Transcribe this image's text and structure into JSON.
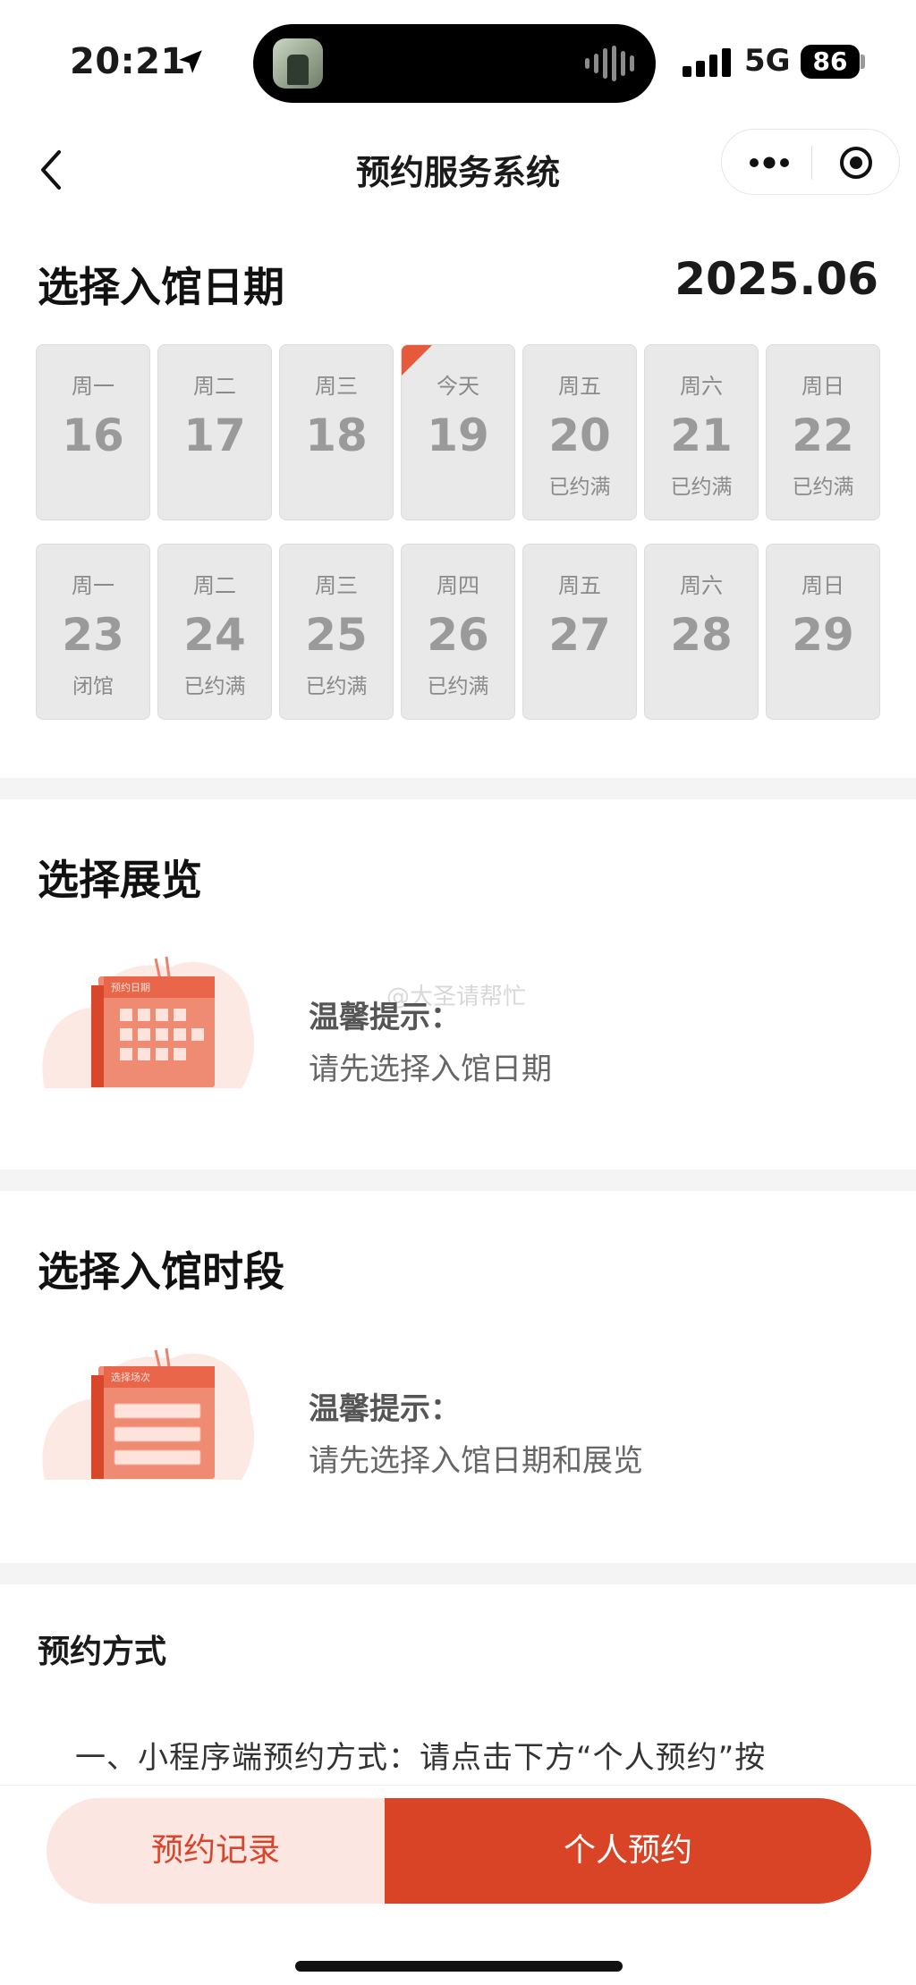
{
  "status_bar": {
    "time": "20:21",
    "network": "5G",
    "battery": "86"
  },
  "nav": {
    "title": "预约服务系统"
  },
  "date_section": {
    "title": "选择入馆日期",
    "month": "2025.06",
    "weeks": [
      [
        {
          "week": "周一",
          "day": "16",
          "status": ""
        },
        {
          "week": "周二",
          "day": "17",
          "status": ""
        },
        {
          "week": "周三",
          "day": "18",
          "status": ""
        },
        {
          "week": "今天",
          "day": "19",
          "status": ""
        },
        {
          "week": "周五",
          "day": "20",
          "status": "已约满"
        },
        {
          "week": "周六",
          "day": "21",
          "status": "已约满"
        },
        {
          "week": "周日",
          "day": "22",
          "status": "已约满"
        }
      ],
      [
        {
          "week": "周一",
          "day": "23",
          "status": "闭馆"
        },
        {
          "week": "周二",
          "day": "24",
          "status": "已约满"
        },
        {
          "week": "周三",
          "day": "25",
          "status": "已约满"
        },
        {
          "week": "周四",
          "day": "26",
          "status": "已约满"
        },
        {
          "week": "周五",
          "day": "27",
          "status": ""
        },
        {
          "week": "周六",
          "day": "28",
          "status": ""
        },
        {
          "week": "周日",
          "day": "29",
          "status": ""
        }
      ]
    ]
  },
  "exhibition_section": {
    "title": "选择展览",
    "illus_label": "预约日期",
    "tip_title": "温馨提示：",
    "tip_text": "请先选择入馆日期"
  },
  "time_section": {
    "title": "选择入馆时段",
    "illus_label": "选择场次",
    "tip_title": "温馨提示：",
    "tip_text": "请先选择入馆日期和展览"
  },
  "watermark": "@大圣请帮忙",
  "method_section": {
    "title": "预约方式",
    "text": "一、小程序端预约方式：请点击下方“个人预约”按"
  },
  "bottom_bar": {
    "records_label": "预约记录",
    "book_label": "个人预约"
  },
  "colors": {
    "accent": "#d94426",
    "accent_light": "#fbe6e1"
  }
}
